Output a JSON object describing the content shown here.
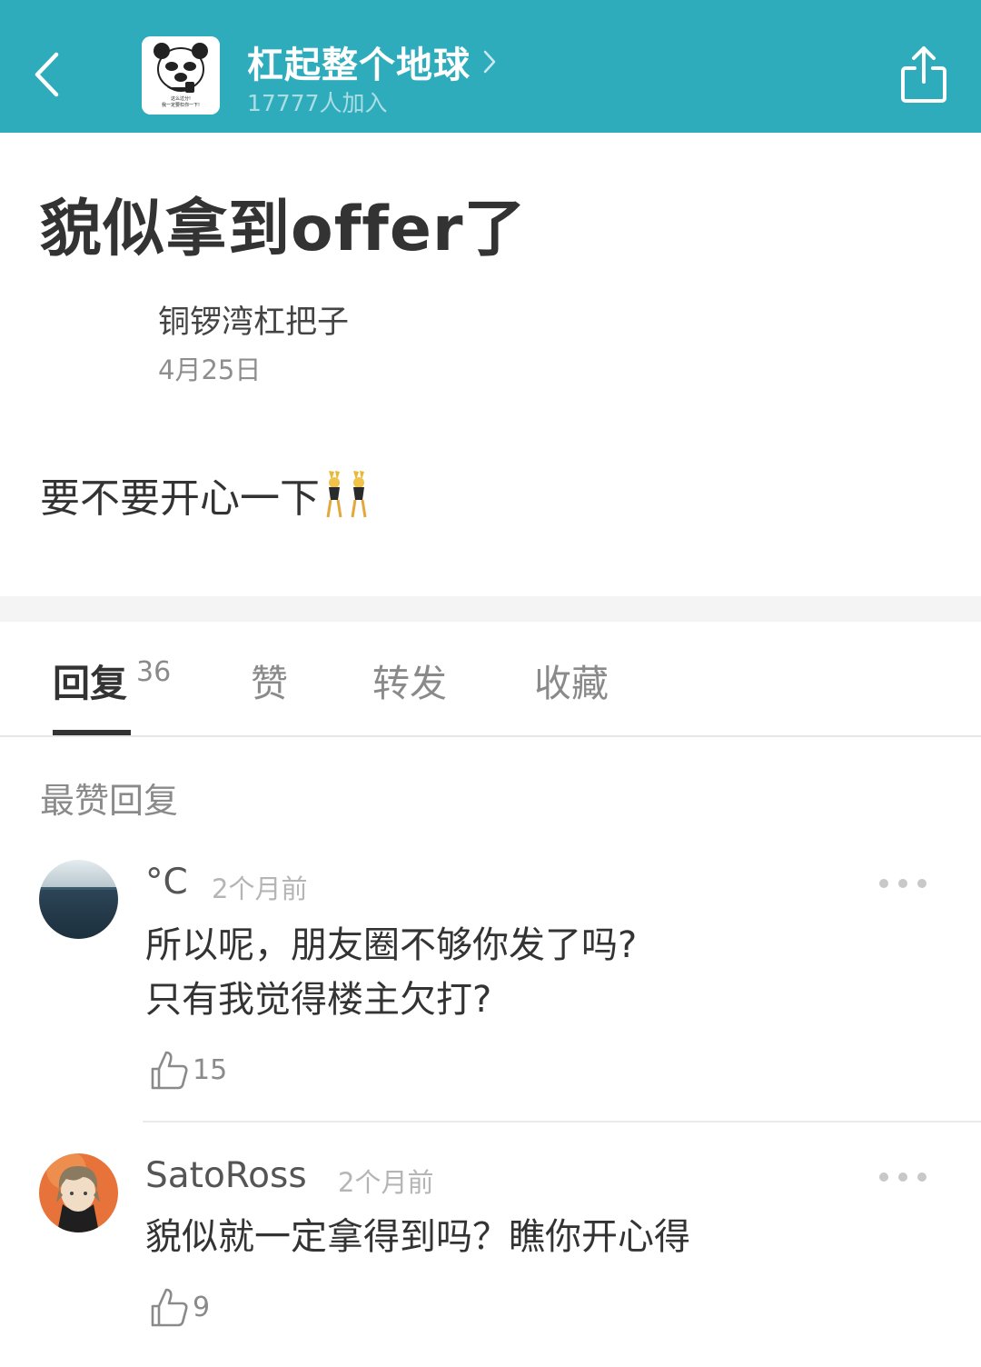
{
  "header": {
    "group_title": "杠起整个地球",
    "group_members": "17777人加入",
    "avatar_caption_line1": "这么过分!",
    "avatar_caption_line2": "我一定要杠你一下!",
    "bg_color": "#2eacbc"
  },
  "post": {
    "title": "貌似拿到offer了",
    "author": "铜锣湾杠把子",
    "date": "4月25日",
    "body": "要不要开心一下"
  },
  "tabs": {
    "reply_label": "回复",
    "reply_count": "36",
    "like_label": "赞",
    "forward_label": "转发",
    "collect_label": "收藏"
  },
  "section_title": "最赞回复",
  "comments": [
    {
      "user": "°C",
      "time": "2个月前",
      "line1": "所以呢，朋友圈不够你发了吗?",
      "line2": "只有我觉得楼主欠打?",
      "likes": "15"
    },
    {
      "user": "SatoRoss",
      "time": "2个月前",
      "line1": "貌似就一定拿得到吗？瞧你开心得",
      "likes": "9"
    }
  ]
}
